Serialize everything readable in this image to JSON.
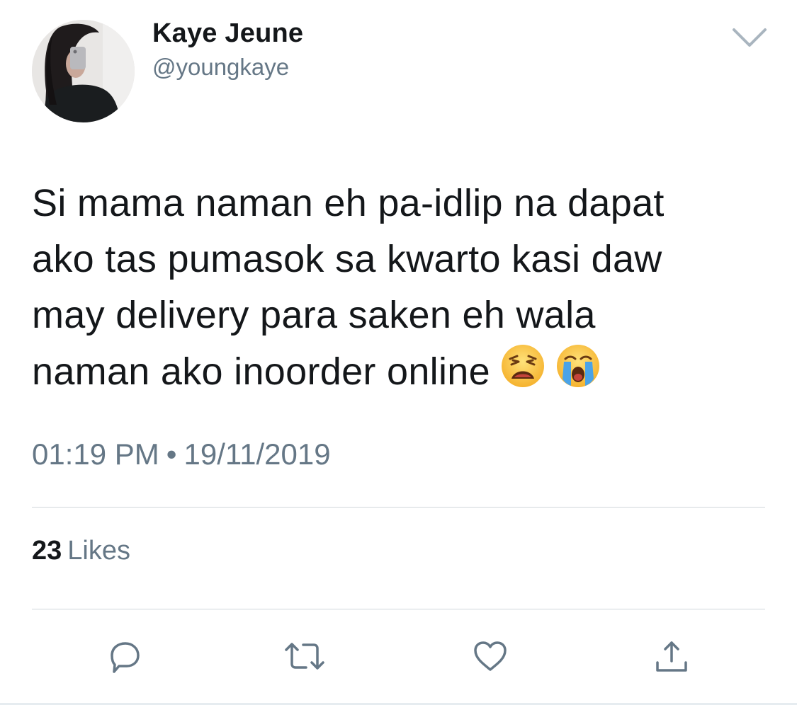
{
  "user": {
    "display_name": "Kaye Jeune",
    "handle": "@youngkaye",
    "avatar_icon": "profile-photo"
  },
  "tweet": {
    "lines": [
      "Si mama naman eh pa-idlip na dapat",
      "ako tas pumasok sa kwarto kasi daw",
      "may delivery para saken eh wala",
      "naman ako inoorder online"
    ],
    "emojis": [
      "weary-face-emoji",
      "loudly-crying-face-emoji"
    ]
  },
  "meta": {
    "time": "01:19 PM",
    "separator": "•",
    "date": "19/11/2019"
  },
  "stats": {
    "likes_count": "23",
    "likes_label": "Likes"
  },
  "actions": {
    "reply_icon": "reply-icon",
    "retweet_icon": "retweet-icon",
    "like_icon": "heart-icon",
    "share_icon": "share-icon",
    "more_icon": "chevron-down-icon"
  },
  "colors": {
    "text_primary": "#14171a",
    "text_secondary": "#657786",
    "divider": "#d0d6db",
    "icon": "#657786"
  }
}
